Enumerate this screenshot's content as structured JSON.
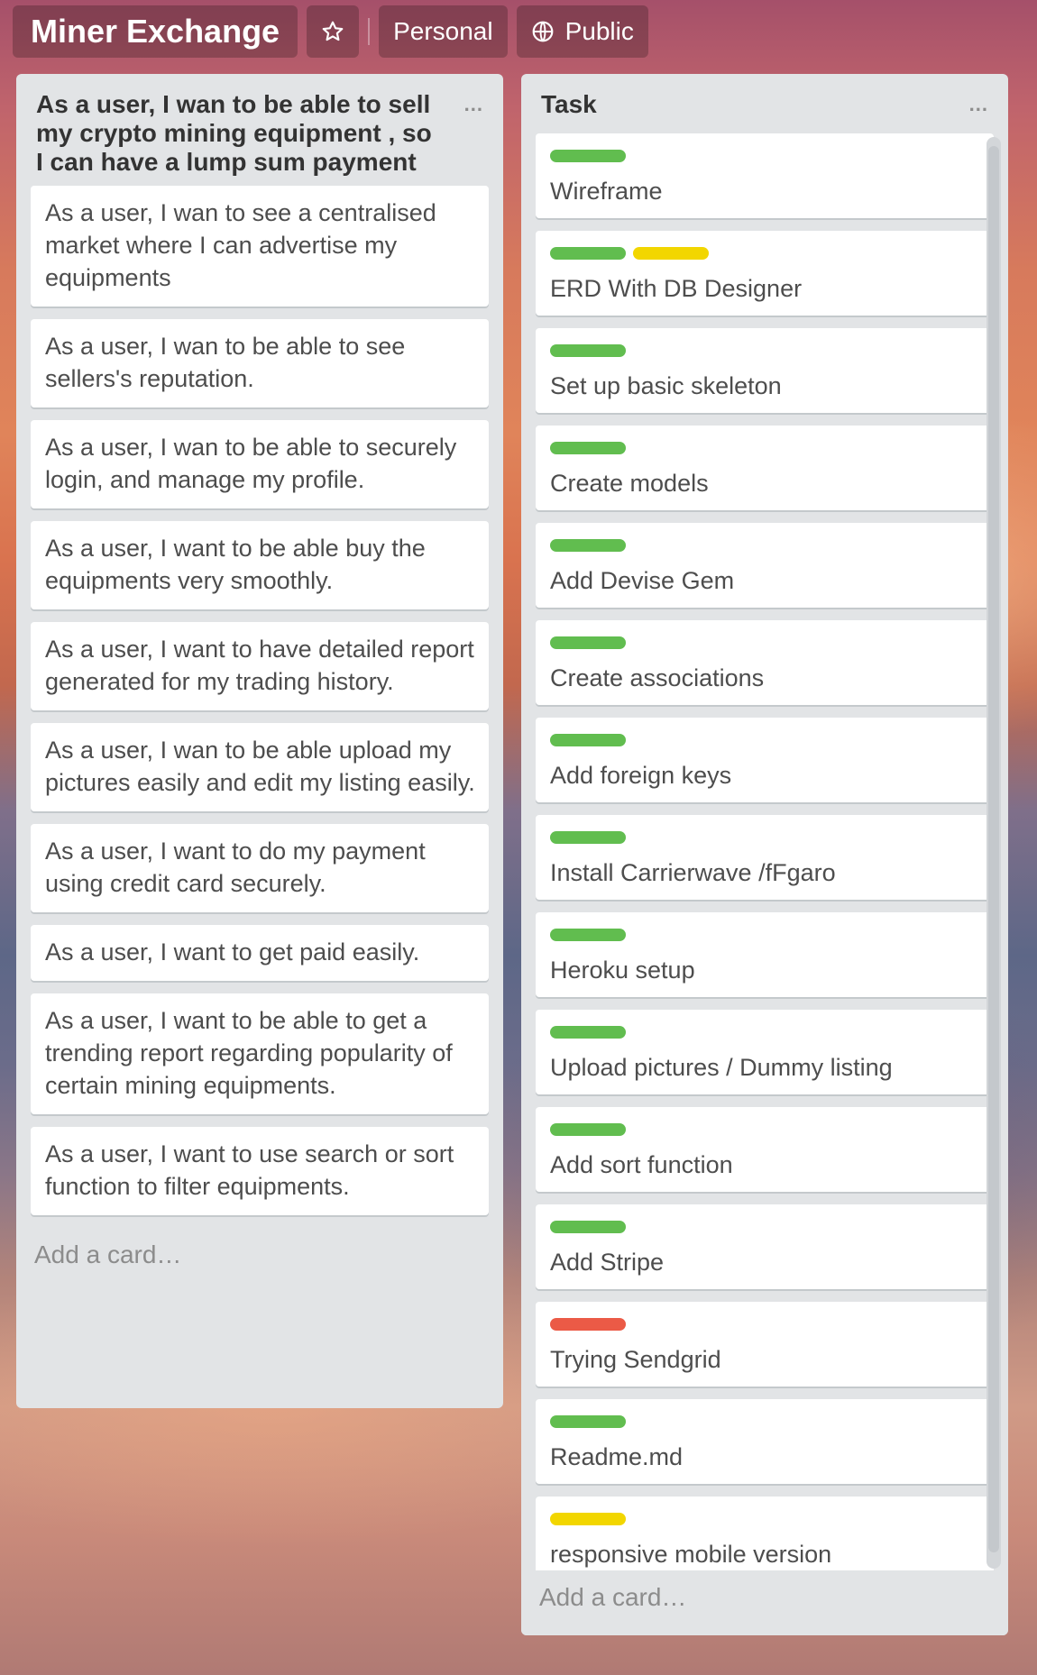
{
  "header": {
    "title": "Miner Exchange",
    "personal_label": "Personal",
    "public_label": "Public"
  },
  "colors": {
    "green": "#61bd4f",
    "yellow": "#f2d600",
    "red": "#eb5a46"
  },
  "lists": [
    {
      "title": "As a user, I wan to be able to sell my crypto mining equipment , so I can have a lump sum payment",
      "menu": "...",
      "add_card": "Add a card…",
      "cards": [
        "As a user, I wan to see a centralised market where I can advertise my equipments",
        "As a user, I wan to be able to see sellers's reputation.",
        "As a user, I wan to be able to securely login, and manage my profile.",
        "As a user, I want to be able buy the equipments very smoothly.",
        "As a user, I want to have detailed report generated for my trading history.",
        "As a user, I wan to be able upload my pictures easily and edit my listing easily.",
        "As a user, I want to do my payment using credit card securely.",
        "As a user, I want to get paid easily.",
        "As a user, I want to be able to get a trending report regarding popularity of certain mining equipments.",
        "As a user, I want to use search or sort function to filter equipments."
      ]
    },
    {
      "title": "Task",
      "menu": "...",
      "add_card": "Add a card…",
      "cards": [
        {
          "title": "Wireframe",
          "labels": [
            "green"
          ]
        },
        {
          "title": "ERD With DB Designer",
          "labels": [
            "green",
            "yellow"
          ]
        },
        {
          "title": "Set up basic skeleton",
          "labels": [
            "green"
          ]
        },
        {
          "title": "Create models",
          "labels": [
            "green"
          ]
        },
        {
          "title": "Add Devise Gem",
          "labels": [
            "green"
          ]
        },
        {
          "title": "Create associations",
          "labels": [
            "green"
          ]
        },
        {
          "title": "Add foreign keys",
          "labels": [
            "green"
          ]
        },
        {
          "title": "Install Carrierwave /fFgaro",
          "labels": [
            "green"
          ]
        },
        {
          "title": "Heroku setup",
          "labels": [
            "green"
          ]
        },
        {
          "title": "Upload pictures / Dummy listing",
          "labels": [
            "green"
          ]
        },
        {
          "title": "Add sort function",
          "labels": [
            "green"
          ]
        },
        {
          "title": "Add Stripe",
          "labels": [
            "green"
          ]
        },
        {
          "title": "Trying Sendgrid",
          "labels": [
            "red"
          ]
        },
        {
          "title": "Readme.md",
          "labels": [
            "green"
          ]
        },
        {
          "title": "responsive mobile version",
          "labels": [
            "yellow"
          ]
        }
      ]
    }
  ]
}
